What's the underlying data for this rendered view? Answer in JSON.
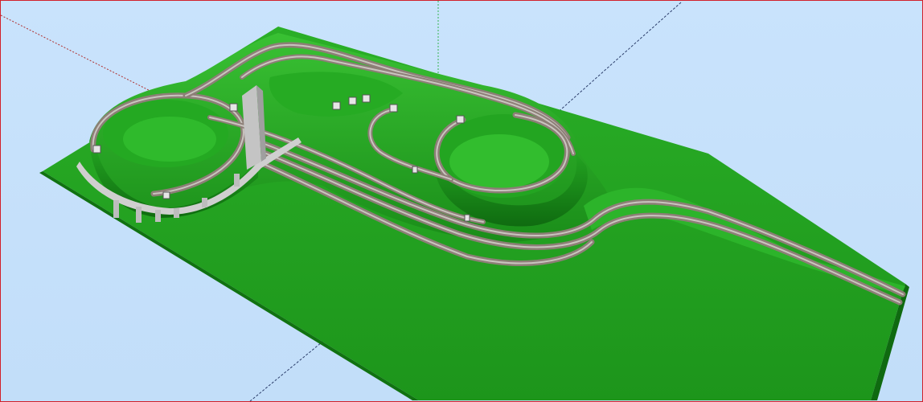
{
  "viewport": {
    "background_color": "#c7e2fb",
    "border_color": "#d2202a"
  },
  "model": {
    "terrain_color": "#1fa11f",
    "terrain_light_color": "#2dbd2a",
    "terrain_dark_color": "#137a13",
    "track_ballast_color": "#8d7f77",
    "track_rail_color": "#c8c8c8",
    "bridge_color": "#d4d4d4",
    "tunnel_portal_color": "#e3e3e3"
  },
  "axes": {
    "red_axis_color": "#c0392b",
    "green_axis_color": "#34b34f",
    "blue_axis_color": "#2c3e6b"
  }
}
